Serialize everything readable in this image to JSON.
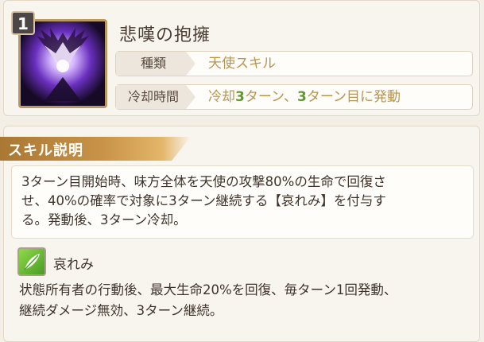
{
  "skill": {
    "level": "1",
    "name": "悲嘆の抱擁",
    "type_label": "種類",
    "type_value": "天使スキル",
    "cooldown_label": "冷却時間",
    "cooldown_part1": "冷却",
    "cooldown_num1": "3",
    "cooldown_part2": "ターン、",
    "cooldown_num2": "3",
    "cooldown_part3": "ターン目に発動",
    "icon": "angel-wings-icon"
  },
  "description": {
    "section_title": "スキル説明",
    "text_line1": "3ターン目開始時、味方全体を天使の攻撃80%の生命で回復さ",
    "text_line2": "せ、40%の確率で対象に3ターン継続する【哀れみ】を付与す",
    "text_line3": "る。発動後、3ターン冷却。"
  },
  "effect": {
    "icon": "feather-icon",
    "name": "哀れみ",
    "desc_line1": "状態所有者の行動後、最大生命20%を回復、毎ターン1回発動、",
    "desc_line2": "継続ダメージ無効、3ターン継続。"
  },
  "colors": {
    "accent_gold": "#b9944f",
    "number_green": "#5f9a2e",
    "ribbon": "#c99449"
  }
}
